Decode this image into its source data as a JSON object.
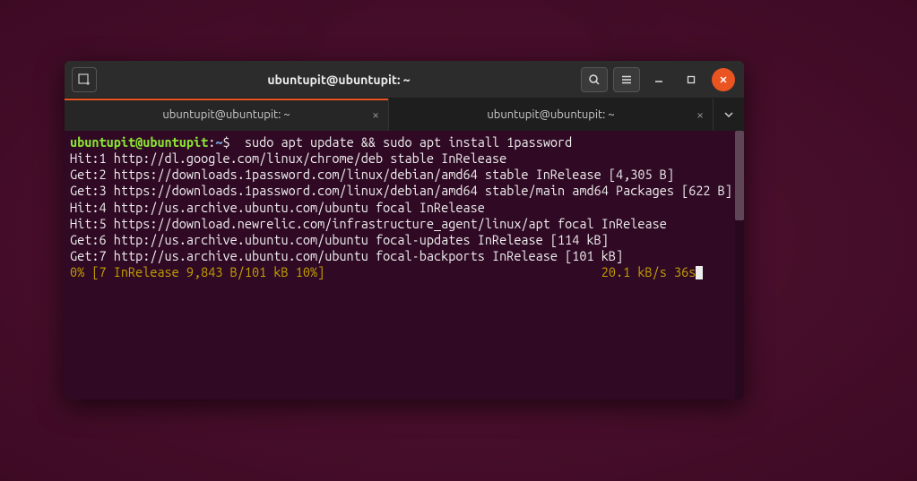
{
  "window": {
    "title": "ubuntupit@ubuntupit: ~"
  },
  "tabs": [
    {
      "label": "ubuntupit@ubuntupit: ~",
      "active": true
    },
    {
      "label": "ubuntupit@ubuntupit: ~",
      "active": false
    }
  ],
  "prompt": {
    "user": "ubuntupit@ubuntupit",
    "path": "~",
    "symbol": "$"
  },
  "command": "  sudo apt update && sudo apt install 1password",
  "output": [
    "Hit:1 http://dl.google.com/linux/chrome/deb stable InRelease",
    "Get:2 https://downloads.1password.com/linux/debian/amd64 stable InRelease [4,305 B]",
    "Get:3 https://downloads.1password.com/linux/debian/amd64 stable/main amd64 Packages [622 B]",
    "Hit:4 http://us.archive.ubuntu.com/ubuntu focal InRelease",
    "Hit:5 https://download.newrelic.com/infrastructure_agent/linux/apt focal InRelease",
    "Get:6 http://us.archive.ubuntu.com/ubuntu focal-updates InRelease [114 kB]",
    "Get:7 http://us.archive.ubuntu.com/ubuntu focal-backports InRelease [101 kB]"
  ],
  "progress_left": "0% [7 InRelease 9,843 B/101 kB 10%]",
  "progress_right": "20.1 kB/s 36s"
}
